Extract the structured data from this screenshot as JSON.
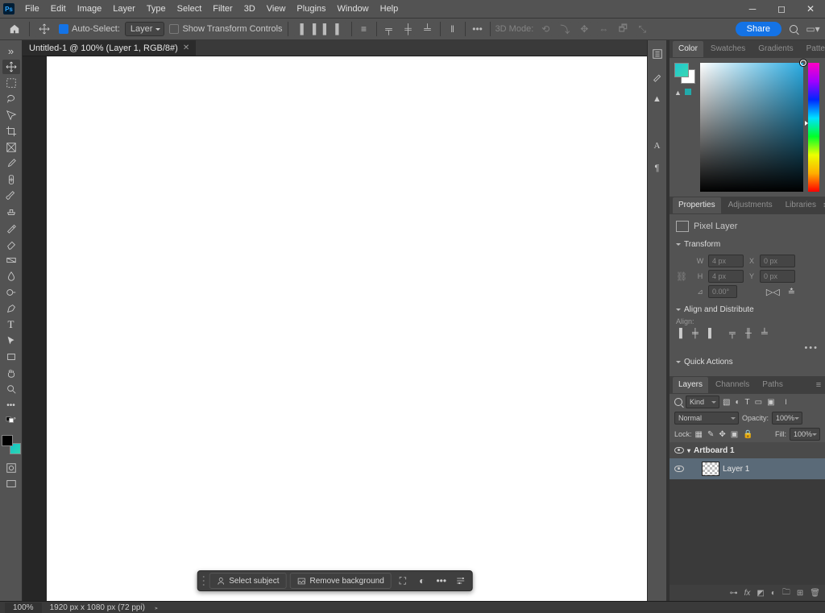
{
  "menubar": {
    "items": [
      "File",
      "Edit",
      "Image",
      "Layer",
      "Type",
      "Select",
      "Filter",
      "3D",
      "View",
      "Plugins",
      "Window",
      "Help"
    ]
  },
  "options": {
    "auto_select_label": "Auto-Select:",
    "target_combo": "Layer",
    "show_transform_label": "Show Transform Controls",
    "threed_mode_label": "3D Mode:",
    "share_label": "Share"
  },
  "document": {
    "tab_title": "Untitled-1 @ 100% (Layer 1, RGB/8#)"
  },
  "context_bar": {
    "select_subject": "Select subject",
    "remove_bg": "Remove background"
  },
  "right_panels": {
    "color_tabs": [
      "Color",
      "Swatches",
      "Gradients",
      "Patterns"
    ],
    "props_tabs": [
      "Properties",
      "Adjustments",
      "Libraries"
    ],
    "props": {
      "kind_label": "Pixel Layer",
      "sec_transform": "Transform",
      "w_label": "W",
      "w_val": "4 px",
      "h_label": "H",
      "h_val": "4 px",
      "x_label": "X",
      "x_val": "0 px",
      "y_label": "Y",
      "y_val": "0 px",
      "rot_val": "0.00°",
      "sec_align": "Align and Distribute",
      "align_label": "Align:",
      "sec_qa": "Quick Actions"
    },
    "layer_tabs": [
      "Layers",
      "Channels",
      "Paths"
    ],
    "layers": {
      "kind_label": "Kind",
      "blend_mode": "Normal",
      "opacity_label": "Opacity:",
      "opacity_val": "100%",
      "lock_label": "Lock:",
      "fill_label": "Fill:",
      "fill_val": "100%",
      "artboard_name": "Artboard 1",
      "layer_name": "Layer 1"
    }
  },
  "status": {
    "zoom": "100%",
    "doc_info": "1920 px x 1080 px (72 ppi)"
  }
}
